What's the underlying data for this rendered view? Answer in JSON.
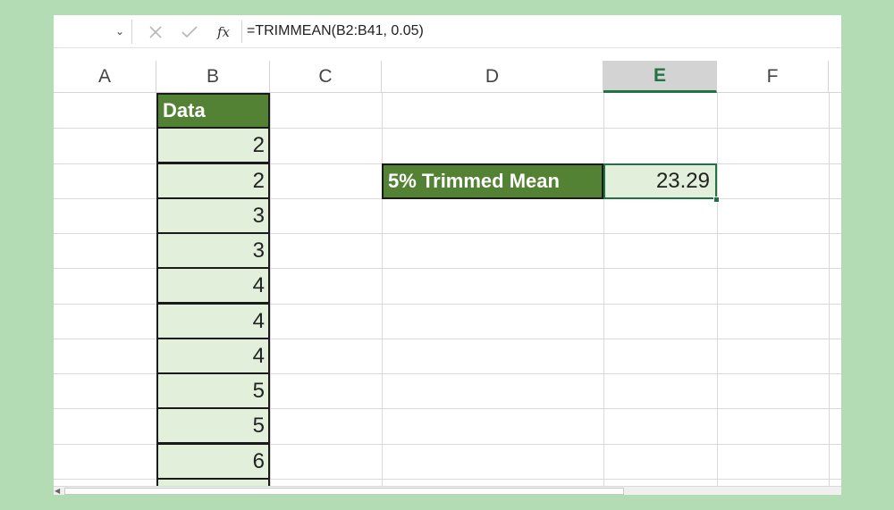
{
  "formula_bar": {
    "name_box": "",
    "formula": "=TRIMMEAN(B2:B41, 0.05)"
  },
  "columns": [
    "A",
    "B",
    "C",
    "D",
    "E",
    "F"
  ],
  "selected_column": "E",
  "data_header": "Data",
  "data_values": [
    "2",
    "2",
    "3",
    "3",
    "4",
    "4",
    "4",
    "5",
    "5",
    "6"
  ],
  "label": "5% Trimmed Mean",
  "result": "23.29",
  "colors": {
    "header_fill": "#548235",
    "cell_fill": "#e2efda",
    "accent": "#217346",
    "background": "#b3dcb4"
  }
}
